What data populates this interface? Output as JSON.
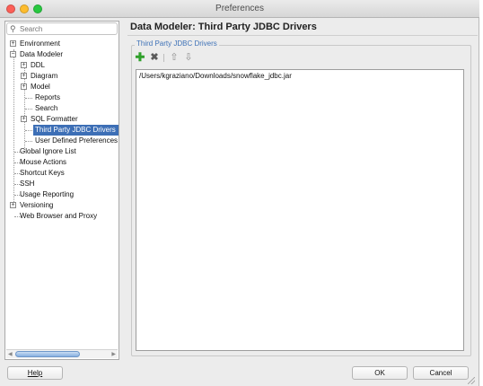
{
  "window": {
    "title": "Preferences"
  },
  "search": {
    "placeholder": "Search"
  },
  "tree": {
    "environment": "Environment",
    "data_modeler": "Data Modeler",
    "ddl": "DDL",
    "diagram": "Diagram",
    "model": "Model",
    "reports": "Reports",
    "search": "Search",
    "sql_formatter": "SQL Formatter",
    "third_party_jdbc": "Third Party JDBC Drivers",
    "user_defined": "User Defined Preferences",
    "global_ignore": "Global Ignore List",
    "mouse_actions": "Mouse Actions",
    "shortcut_keys": "Shortcut Keys",
    "ssh": "SSH",
    "usage_reporting": "Usage Reporting",
    "versioning": "Versioning",
    "web_browser": "Web Browser and Proxy",
    "expander_plus": "+",
    "expander_minus": "−"
  },
  "content": {
    "title": "Data Modeler: Third Party JDBC Drivers",
    "group_label": "Third Party JDBC Drivers",
    "drivers": [
      "/Users/kgraziano/Downloads/snowflake_jdbc.jar"
    ]
  },
  "toolbar": {
    "add_glyph": "✚",
    "remove_glyph": "✖",
    "up_glyph": "⇧",
    "down_glyph": "⇩"
  },
  "buttons": {
    "help": "Help",
    "ok": "OK",
    "cancel": "Cancel"
  },
  "colors": {
    "selection": "#3d6fb6",
    "group_label": "#3f72b7",
    "add_icon": "#2fa02b"
  }
}
